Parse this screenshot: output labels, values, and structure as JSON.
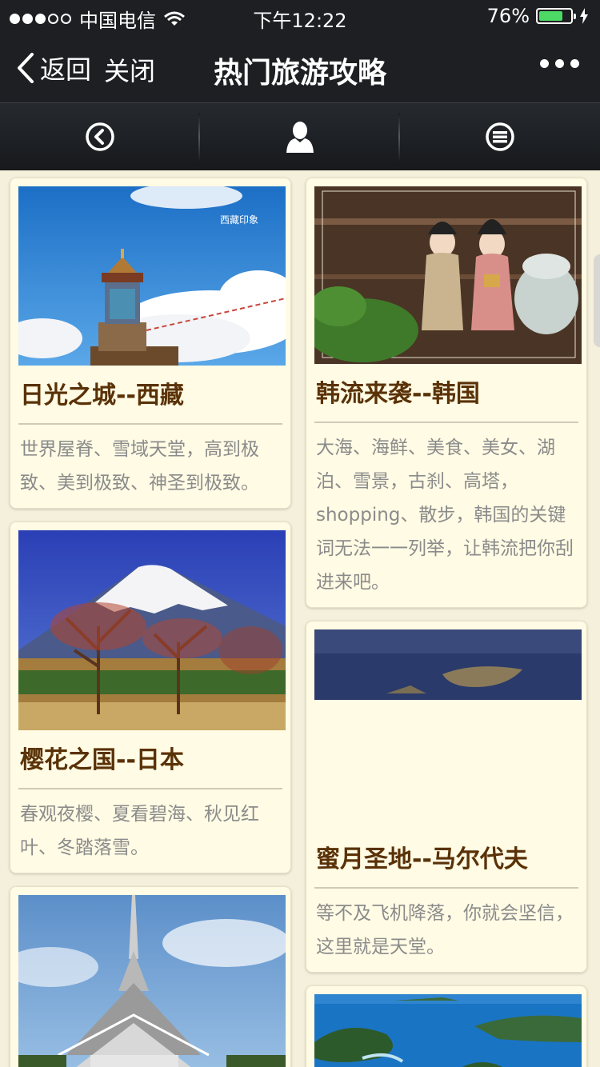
{
  "status": {
    "carrier": "中国电信",
    "time": "下午12:22",
    "battery": "76%",
    "battery_level": 0.76
  },
  "nav": {
    "back_label": "返回",
    "close_label": "关闭",
    "title": "热门旅游攻略"
  },
  "toolbar": {
    "icons": [
      "back-circle-icon",
      "user-icon",
      "menu-circle-icon"
    ]
  },
  "cards": [
    {
      "title": "日光之城--西藏",
      "desc": "世界屋脊、雪域天堂，高到极致、美到极致、神圣到极致。",
      "image_caption": "西藏印象"
    },
    {
      "title": "韩流来袭--韩国",
      "desc": "大海、海鲜、美食、美女、湖泊、雪景，古刹、高塔，shopping、散步，韩国的关键词无法一一列举，让韩流把你刮进来吧。"
    },
    {
      "title": "樱花之国--日本",
      "desc": "春观夜樱、夏看碧海、秋见红叶、冬踏落雪。"
    },
    {
      "title": "蜜月圣地--马尔代夫",
      "desc": "等不及飞机降落，你就会坚信，这里就是天堂。"
    },
    {
      "title": "",
      "desc": ""
    },
    {
      "title": "",
      "desc": ""
    }
  ],
  "colors": {
    "bar_bg": "#1e1f23",
    "page_bg": "#f5f0dc",
    "card_bg": "#fffbe4",
    "title_color": "#5a3208",
    "desc_color": "#8b8b8b",
    "battery_green": "#4cd964"
  }
}
